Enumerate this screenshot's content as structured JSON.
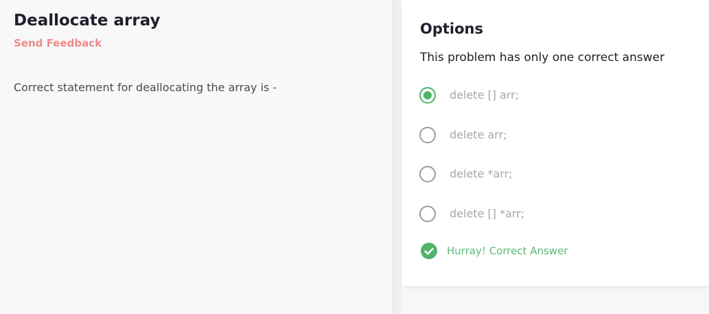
{
  "problem": {
    "title": "Deallocate array",
    "feedback_label": "Send Feedback",
    "statement": "Correct statement for deallocating the array is -"
  },
  "options_panel": {
    "heading": "Options",
    "subtitle": "This problem has only one correct answer",
    "options": [
      {
        "label": "delete [] arr;",
        "selected": true
      },
      {
        "label": "delete arr;",
        "selected": false
      },
      {
        "label": "delete *arr;",
        "selected": false
      },
      {
        "label": "delete [] *arr;",
        "selected": false
      }
    ],
    "result": {
      "message": "Hurray! Correct Answer",
      "icon": "check-circle-icon"
    }
  },
  "colors": {
    "accent_green": "#4fb36a",
    "feedback_red": "#f08a8a"
  }
}
